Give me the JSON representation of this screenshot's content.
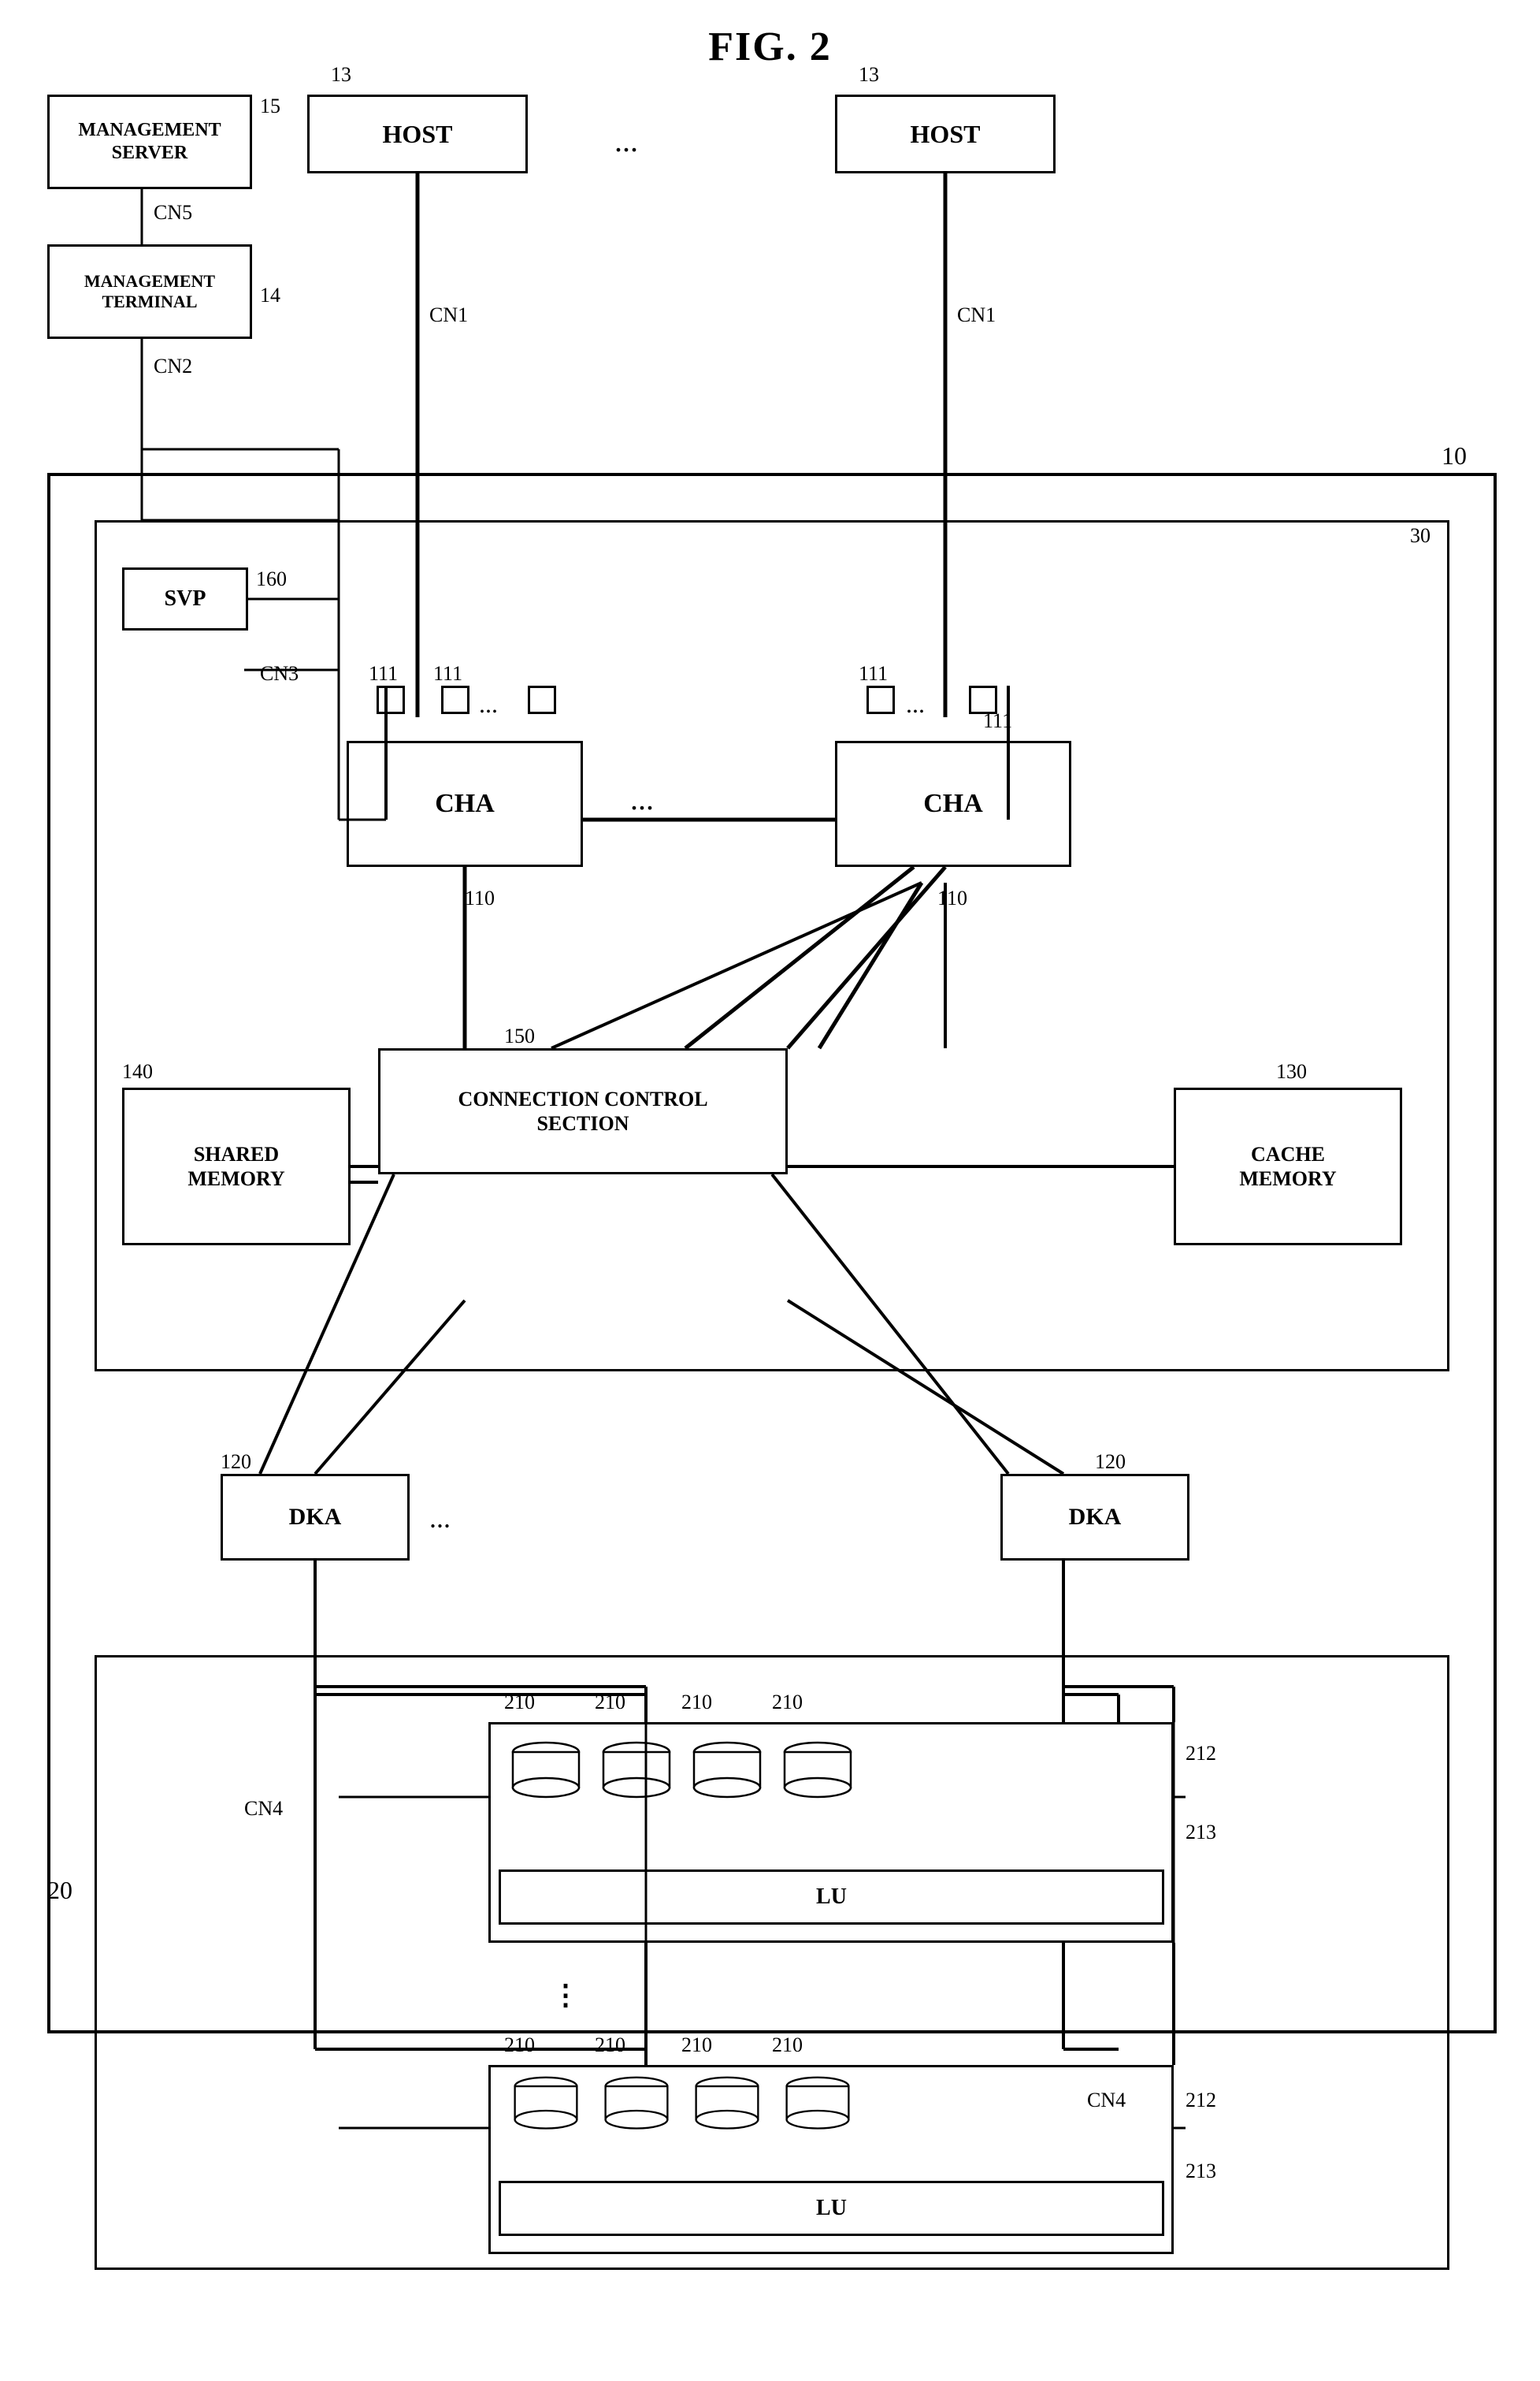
{
  "title": "FIG. 2",
  "boxes": {
    "management_server": {
      "label": "MANAGEMENT\nSERVER"
    },
    "management_terminal": {
      "label": "MANAGEMENT\nTERMINAL"
    },
    "host1": {
      "label": "HOST"
    },
    "host2": {
      "label": "HOST"
    },
    "svp": {
      "label": "SVP"
    },
    "cha1": {
      "label": "CHA"
    },
    "cha2": {
      "label": "CHA"
    },
    "shared_memory": {
      "label": "SHARED\nMEMORY"
    },
    "connection_control": {
      "label": "CONNECTION CONTROL\nSECTION"
    },
    "cache_memory": {
      "label": "CACHE\nMEMORY"
    },
    "dka1": {
      "label": "DKA"
    },
    "dka2": {
      "label": "DKA"
    },
    "lu1": {
      "label": "LU"
    },
    "lu2": {
      "label": "LU"
    }
  },
  "ref_numbers": {
    "n10": "10",
    "n13a": "13",
    "n13b": "13",
    "n14": "14",
    "n15": "15",
    "n20": "20",
    "n30": "30",
    "n110a": "110",
    "n110b": "110",
    "n111a": "111",
    "n111b": "111",
    "n111c": "111",
    "n111d": "111",
    "n120a": "120",
    "n120b": "120",
    "n130": "130",
    "n140": "140",
    "n150": "150",
    "n160": "160",
    "n210a": "210",
    "n210b": "210",
    "n210c": "210",
    "n210d": "210",
    "n210e": "210",
    "n210f": "210",
    "n210g": "210",
    "n210h": "210",
    "n212a": "212",
    "n212b": "212",
    "n213a": "213",
    "n213b": "213",
    "cn1a": "CN1",
    "cn1b": "CN1",
    "cn2": "CN2",
    "cn3": "CN3",
    "cn4a": "CN4",
    "cn4b": "CN4",
    "cn5": "CN5",
    "dots1": "...",
    "dots2": "...",
    "dots3": "...",
    "dots4": "...",
    "dots5": "..."
  },
  "colors": {
    "border": "#000000",
    "background": "#ffffff",
    "text": "#000000"
  }
}
